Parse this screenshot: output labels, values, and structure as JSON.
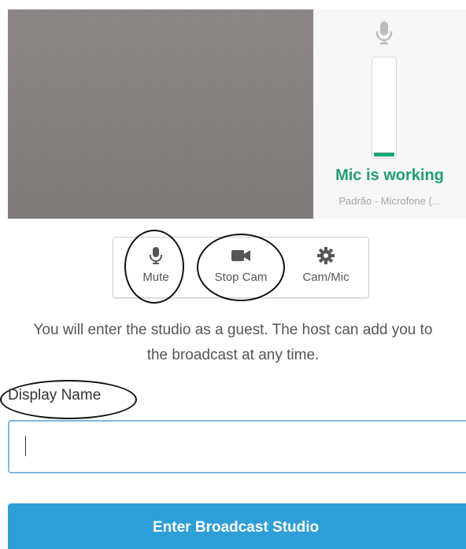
{
  "mic_panel": {
    "status": "Mic is working",
    "device": "Padrão - Microfone (...",
    "level_percent": 4
  },
  "controls": {
    "mute_label": "Mute",
    "stop_cam_label": "Stop Cam",
    "cam_mic_label": "Cam/Mic"
  },
  "info": {
    "line1": "You will enter the studio as a guest. The host can add you to",
    "line2": "the broadcast at any time."
  },
  "form": {
    "display_name_label": "Display Name",
    "display_name_value": "",
    "display_name_placeholder": ""
  },
  "enter_button_label": "Enter Broadcast Studio",
  "colors": {
    "accent": "#2e9ed9",
    "mic_ok": "#1f9e75",
    "input_border": "#7db9db"
  },
  "icons": {
    "mic": "microphone-icon",
    "camera": "video-camera-icon",
    "settings": "gear-icon"
  }
}
